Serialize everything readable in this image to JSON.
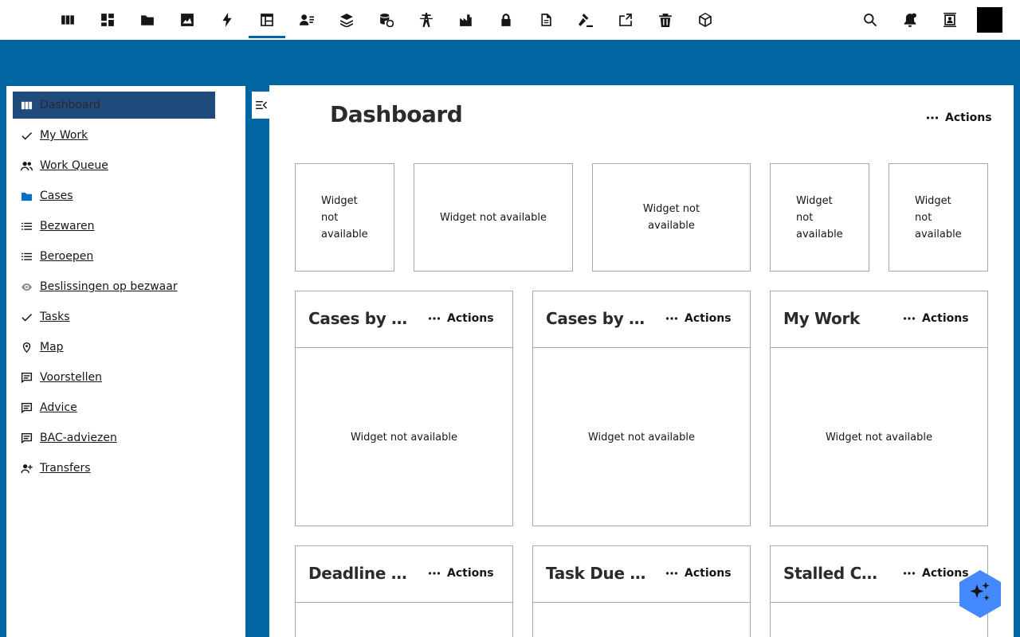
{
  "topbar": {
    "icons": [
      {
        "name": "dashboard-columns-icon"
      },
      {
        "name": "grid-icon"
      },
      {
        "name": "folder-icon"
      },
      {
        "name": "image-icon"
      },
      {
        "name": "lightning-icon"
      },
      {
        "name": "table-icon"
      },
      {
        "name": "user-list-icon"
      },
      {
        "name": "layers-icon"
      },
      {
        "name": "database-icon"
      },
      {
        "name": "tower-icon"
      },
      {
        "name": "factory-icon"
      },
      {
        "name": "lock-icon"
      },
      {
        "name": "document-icon"
      },
      {
        "name": "gavel-icon"
      },
      {
        "name": "code-window-icon"
      },
      {
        "name": "trash-icon"
      },
      {
        "name": "cube-icon"
      }
    ],
    "right_icons": [
      {
        "name": "search-icon"
      },
      {
        "name": "notifications-icon"
      },
      {
        "name": "contact-card-icon"
      }
    ]
  },
  "sidebar": {
    "items": [
      {
        "label": "Dashboard",
        "icon": "dashboard-columns-icon",
        "active": true
      },
      {
        "label": "My Work",
        "icon": "checkmark-icon"
      },
      {
        "label": "Work Queue",
        "icon": "users-icon"
      },
      {
        "label": "Cases",
        "icon": "folder-icon"
      },
      {
        "label": "Bezwaren",
        "icon": "list-icon"
      },
      {
        "label": "Beroepen",
        "icon": "list-icon"
      },
      {
        "label": "Beslissingen op bezwaar",
        "icon": "eye-icon"
      },
      {
        "label": "Tasks",
        "icon": "checkmark-icon"
      },
      {
        "label": "Map",
        "icon": "location-pin-icon"
      },
      {
        "label": "Voorstellen",
        "icon": "comment-icon"
      },
      {
        "label": "Advice",
        "icon": "comment-icon"
      },
      {
        "label": "BAC-adviezen",
        "icon": "comment-icon"
      },
      {
        "label": "Transfers",
        "icon": "user-add-icon"
      }
    ]
  },
  "main": {
    "title": "Dashboard",
    "actions_label": "Actions",
    "widget_unavailable": "Widget not available",
    "small_widgets": [
      {
        "text": "Widget not available"
      },
      {
        "text": "Widget not available"
      },
      {
        "text": "Widget not available"
      },
      {
        "text": "Widget not available"
      },
      {
        "text": "Widget not available"
      }
    ],
    "cards": [
      {
        "title": "Cases by S...",
        "actions": "Actions",
        "body": "Widget not available"
      },
      {
        "title": "Cases by T...",
        "actions": "Actions",
        "body": "Widget not available"
      },
      {
        "title": "My Work",
        "actions": "Actions",
        "body": "Widget not available"
      },
      {
        "title": "Deadline A...",
        "actions": "Actions",
        "body": ""
      },
      {
        "title": "Task Due R...",
        "actions": "Actions",
        "body": ""
      },
      {
        "title": "Stalled Ca...",
        "actions": "Actions",
        "body": ""
      }
    ]
  },
  "colors": {
    "brand": "#0065a1",
    "active_nav": "#1e4b7c",
    "border": "#a8a8a8",
    "fab": "#4589ff"
  }
}
